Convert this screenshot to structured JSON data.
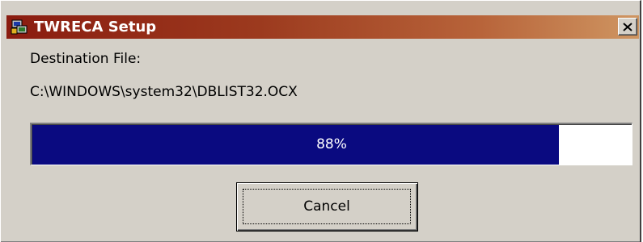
{
  "window": {
    "title": "TWRECA Setup",
    "close_glyph": "✕",
    "icon": "setup-installer-icon"
  },
  "content": {
    "destination_label": "Destination File:",
    "file_path": "C:\\WINDOWS\\system32\\DBLIST32.OCX"
  },
  "progress": {
    "percent": 88,
    "text": "88%",
    "fill_color": "#0a0a80"
  },
  "buttons": {
    "cancel_label": "Cancel"
  },
  "colors": {
    "titlebar_start": "#8a1c10",
    "titlebar_end": "#cf9662",
    "dialog_face": "#d4d0c8"
  }
}
